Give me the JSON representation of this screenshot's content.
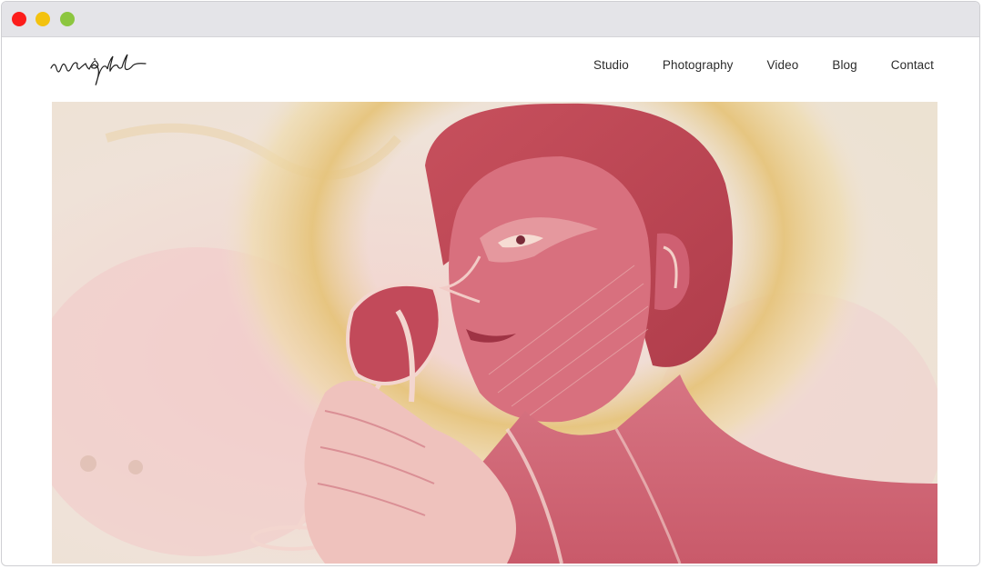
{
  "window": {
    "traffic_lights": [
      {
        "name": "close",
        "color": "#fc1d1b"
      },
      {
        "name": "minimize",
        "color": "#f3c20f"
      },
      {
        "name": "zoom",
        "color": "#8cc63f"
      }
    ]
  },
  "site": {
    "logo_text": "wright",
    "nav": [
      {
        "label": "Studio"
      },
      {
        "label": "Photography"
      },
      {
        "label": "Video"
      },
      {
        "label": "Blog"
      },
      {
        "label": "Contact"
      }
    ]
  },
  "hero": {
    "image_subject": "watercolor-portrait-with-gold-halo",
    "colors": {
      "background": "#efe3db",
      "rose": "#c95a6a",
      "deep_rose": "#b8414f",
      "gold": "#e3c27a",
      "skin_light": "#f1cdc6"
    }
  }
}
